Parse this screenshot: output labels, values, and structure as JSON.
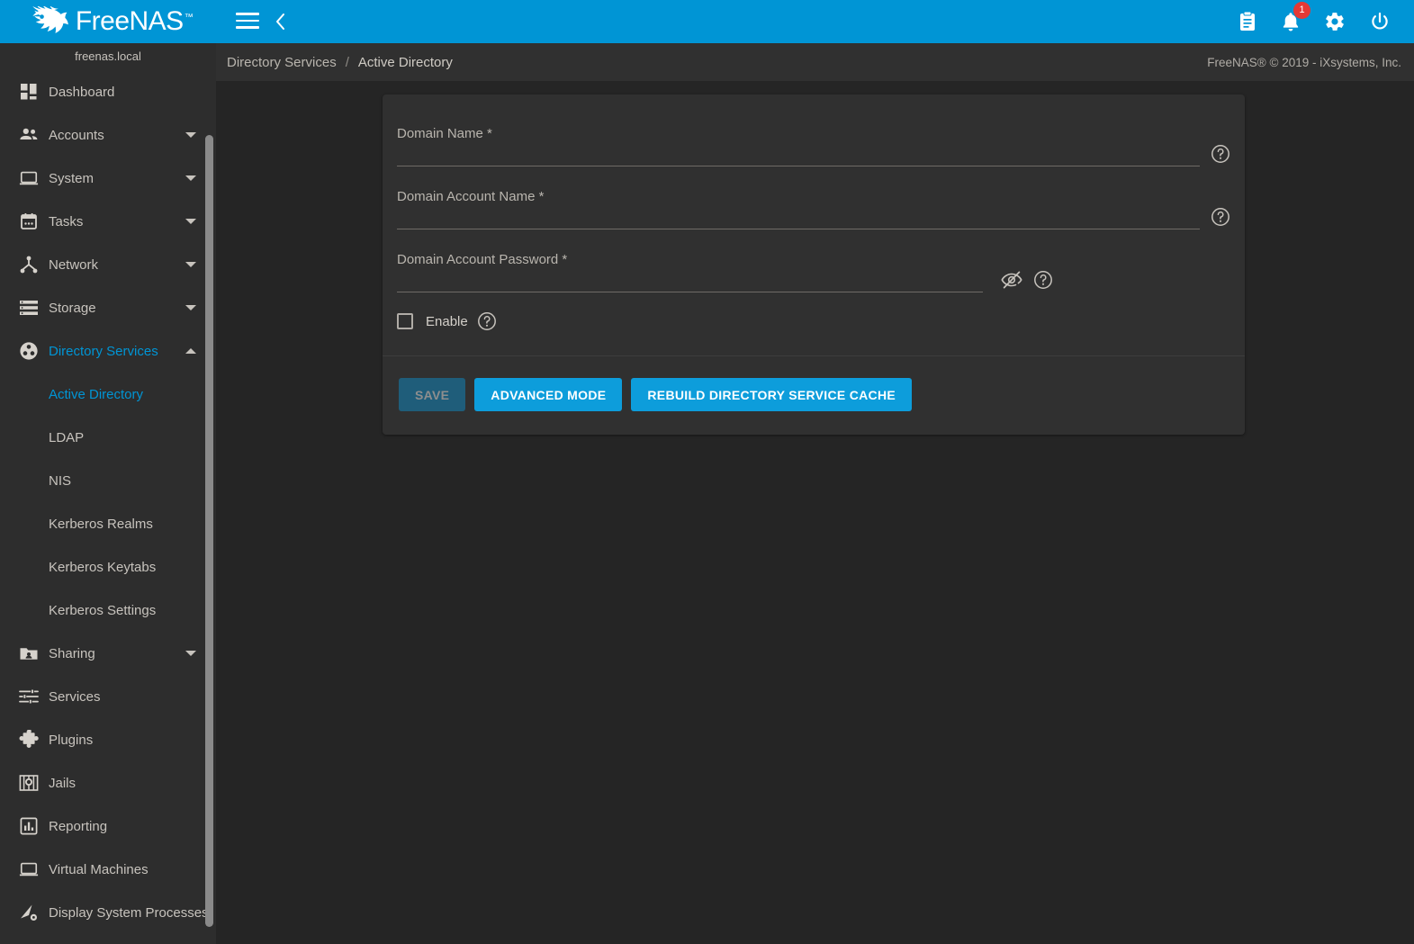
{
  "topbar": {
    "brand_name": "FreeNAS",
    "brand_tm": "™",
    "menu_icon": "hamburger-icon",
    "collapse_icon": "chevron-left-icon",
    "right_icons": [
      {
        "name": "clipboard-icon",
        "label": "Task Manager"
      },
      {
        "name": "bell-icon",
        "label": "Alerts",
        "badge": "1"
      },
      {
        "name": "gear-icon",
        "label": "Settings"
      },
      {
        "name": "power-icon",
        "label": "Power"
      }
    ]
  },
  "sidebar": {
    "host": "freenas.local",
    "items": [
      {
        "label": "Dashboard",
        "icon": "dashboard-icon",
        "expandable": false
      },
      {
        "label": "Accounts",
        "icon": "accounts-icon",
        "expandable": true
      },
      {
        "label": "System",
        "icon": "system-icon",
        "expandable": true
      },
      {
        "label": "Tasks",
        "icon": "tasks-icon",
        "expandable": true
      },
      {
        "label": "Network",
        "icon": "network-icon",
        "expandable": true
      },
      {
        "label": "Storage",
        "icon": "storage-icon",
        "expandable": true
      },
      {
        "label": "Directory Services",
        "icon": "directory-services-icon",
        "expandable": true,
        "expanded": true,
        "active": true
      },
      {
        "label": "Sharing",
        "icon": "sharing-icon",
        "expandable": true
      },
      {
        "label": "Services",
        "icon": "services-icon",
        "expandable": false
      },
      {
        "label": "Plugins",
        "icon": "plugins-icon",
        "expandable": false
      },
      {
        "label": "Jails",
        "icon": "jails-icon",
        "expandable": false
      },
      {
        "label": "Reporting",
        "icon": "reporting-icon",
        "expandable": false
      },
      {
        "label": "Virtual Machines",
        "icon": "virtual-machines-icon",
        "expandable": false
      },
      {
        "label": "Display System Processes",
        "icon": "display-system-processes-icon",
        "expandable": false
      }
    ],
    "directory_services_children": [
      {
        "label": "Active Directory",
        "active": true
      },
      {
        "label": "LDAP",
        "active": false
      },
      {
        "label": "NIS",
        "active": false
      },
      {
        "label": "Kerberos Realms",
        "active": false
      },
      {
        "label": "Kerberos Keytabs",
        "active": false
      },
      {
        "label": "Kerberos Settings",
        "active": false
      }
    ]
  },
  "breadcrumb": {
    "parent": "Directory Services",
    "separator": "/",
    "current": "Active Directory",
    "copyright": "FreeNAS® © 2019 - iXsystems, Inc."
  },
  "form": {
    "fields": [
      {
        "label": "Domain Name *",
        "value": "",
        "placeholder": "",
        "type": "text",
        "help_icon": "help-circle-icon"
      },
      {
        "label": "Domain Account Name *",
        "value": "",
        "placeholder": "",
        "type": "text",
        "help_icon": "help-circle-icon"
      },
      {
        "label": "Domain Account Password *",
        "value": "",
        "placeholder": "",
        "type": "password",
        "visibility_icon": "eye-off-icon",
        "help_icon": "help-circle-icon"
      }
    ],
    "checkbox": {
      "label": "Enable",
      "checked": false,
      "help_icon": "help-circle-icon"
    },
    "buttons": [
      {
        "label": "SAVE",
        "state": "disabled"
      },
      {
        "label": "ADVANCED MODE",
        "state": "enabled"
      },
      {
        "label": "REBUILD DIRECTORY SERVICE CACHE",
        "state": "enabled"
      }
    ]
  },
  "colors": {
    "accent": "#0095d5",
    "topbar": "#0095d5",
    "sidebar_bg": "#2d2d2d",
    "content_bg": "#252525",
    "card_bg": "#303030",
    "badge_red": "#e53935",
    "button_blue": "#0d9ddb",
    "button_disabled": "#1f5d7a",
    "text_primary": "#c7c3bd"
  }
}
